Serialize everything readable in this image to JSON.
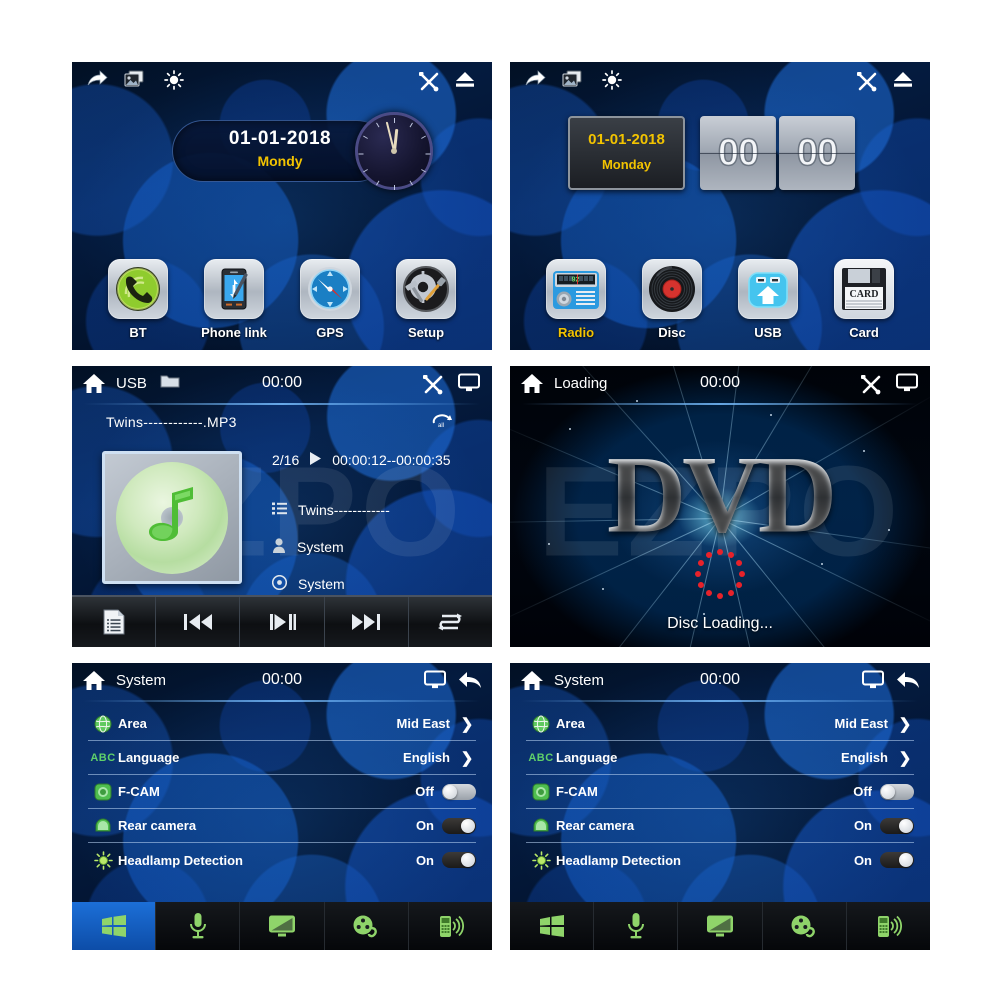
{
  "panels": {
    "home1": {
      "name": "Home screen 1",
      "toolbar_left": [
        "share-arrow-icon",
        "photo-gallery-icon",
        "brightness-icon"
      ],
      "toolbar_right": [
        "tools-icon",
        "eject-icon"
      ],
      "clock": {
        "date": "01-01-2018",
        "weekday": "Mondy"
      },
      "apps": [
        {
          "label": "BT",
          "icon": "bluetooth-phone-icon",
          "highlighted": false
        },
        {
          "label": "Phone link",
          "icon": "phone-link-icon",
          "highlighted": false
        },
        {
          "label": "GPS",
          "icon": "compass-icon",
          "highlighted": false
        },
        {
          "label": "Setup",
          "icon": "gear-tools-icon",
          "highlighted": false
        }
      ]
    },
    "home2": {
      "name": "Home screen 2",
      "toolbar_left": [
        "share-arrow-icon",
        "photo-gallery-icon",
        "brightness-icon"
      ],
      "toolbar_right": [
        "tools-icon",
        "eject-icon"
      ],
      "clock": {
        "date": "01-01-2018",
        "weekday": "Monday",
        "hours": "00",
        "minutes": "00"
      },
      "apps": [
        {
          "label": "Radio",
          "icon": "radio-icon",
          "highlighted": true
        },
        {
          "label": "Disc",
          "icon": "vinyl-disc-icon",
          "highlighted": false
        },
        {
          "label": "USB",
          "icon": "usb-icon",
          "highlighted": false
        },
        {
          "label": "Card",
          "icon": "sd-card-icon",
          "highlighted": false
        }
      ]
    },
    "usb": {
      "name": "USB music player",
      "header": {
        "title": "USB",
        "time": "00:00",
        "left_icons": [
          "home-icon",
          "folder-icon"
        ],
        "right_icons": [
          "tools-icon",
          "display-icon"
        ]
      },
      "track_file": "Twins------------.MP3",
      "repeat_mode_icon": "repeat-all-icon",
      "track_index": "2/16",
      "play_state_icon": "play-icon",
      "elapsed_total": "00:00:12--00:00:35",
      "watermark": "EZPO",
      "album_art_icon": "music-note-disc-icon",
      "meta": [
        {
          "icon": "playlist-icon",
          "value": "Twins------------"
        },
        {
          "icon": "artist-icon",
          "value": "System"
        },
        {
          "icon": "album-icon",
          "value": "System"
        }
      ],
      "controls": [
        "list-icon",
        "previous-icon",
        "play-pause-icon",
        "next-icon",
        "repeat-icon"
      ]
    },
    "dvd": {
      "name": "DVD loading screen",
      "header": {
        "title": "Loading",
        "time": "00:00",
        "left_icons": [
          "home-icon"
        ],
        "right_icons": [
          "tools-icon",
          "display-icon"
        ]
      },
      "logo_text": "DVD",
      "watermark": "EZPO",
      "status": "Disc Loading..."
    },
    "system_a": {
      "name": "System settings (Windows tab active)",
      "header": {
        "title": "System",
        "time": "00:00",
        "left_icons": [
          "home-icon"
        ],
        "right_icons": [
          "display-icon",
          "back-arrow-icon"
        ]
      },
      "rows": [
        {
          "icon": "globe-icon",
          "label": "Area",
          "value": "Mid East",
          "control": "chevron"
        },
        {
          "icon": "abc-icon",
          "label": "Language",
          "value": "English",
          "control": "chevron"
        },
        {
          "icon": "front-cam-icon",
          "label": "F-CAM",
          "value": "Off",
          "control": "toggle",
          "on": false
        },
        {
          "icon": "rear-cam-icon",
          "label": "Rear camera",
          "value": "On",
          "control": "toggle",
          "on": true
        },
        {
          "icon": "headlamp-icon",
          "label": "Headlamp Detection",
          "value": "On",
          "control": "toggle",
          "on": true
        }
      ],
      "tabs": [
        {
          "icon": "windows-icon",
          "active": true
        },
        {
          "icon": "microphone-icon",
          "active": false
        },
        {
          "icon": "monitor-icon",
          "active": false
        },
        {
          "icon": "film-reel-icon",
          "active": false
        },
        {
          "icon": "mobile-phone-icon",
          "active": false
        }
      ]
    },
    "system_b": {
      "name": "System settings (no tab active)",
      "header": {
        "title": "System",
        "time": "00:00",
        "left_icons": [
          "home-icon"
        ],
        "right_icons": [
          "display-icon",
          "back-arrow-icon"
        ]
      },
      "rows": [
        {
          "icon": "globe-icon",
          "label": "Area",
          "value": "Mid East",
          "control": "chevron"
        },
        {
          "icon": "abc-icon",
          "label": "Language",
          "value": "English",
          "control": "chevron"
        },
        {
          "icon": "front-cam-icon",
          "label": "F-CAM",
          "value": "Off",
          "control": "toggle",
          "on": false
        },
        {
          "icon": "rear-cam-icon",
          "label": "Rear camera",
          "value": "On",
          "control": "toggle",
          "on": true
        },
        {
          "icon": "headlamp-icon",
          "label": "Headlamp Detection",
          "value": "On",
          "control": "toggle",
          "on": true
        }
      ],
      "tabs": [
        {
          "icon": "windows-icon",
          "active": false
        },
        {
          "icon": "microphone-icon",
          "active": false
        },
        {
          "icon": "monitor-icon",
          "active": false
        },
        {
          "icon": "film-reel-icon",
          "active": false
        },
        {
          "icon": "mobile-phone-icon",
          "active": false
        }
      ]
    }
  },
  "colors": {
    "accent_blue": "#1c6fd8",
    "highlight_yellow": "#f2c300",
    "icon_green": "#6ec96e",
    "panel_bg": "#020c1c"
  }
}
